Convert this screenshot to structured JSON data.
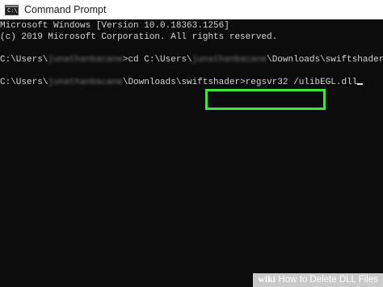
{
  "window": {
    "title": "Command Prompt",
    "icon": "cmd-console-icon",
    "icon_glyph": "C:\\"
  },
  "console": {
    "line1": "Microsoft Windows [Version 10.0.18363.1256]",
    "line2": "(c) 2019 Microsoft Corporation. All rights reserved.",
    "line3_prefix": "C:\\Users\\",
    "line3_user": "junathanbacane",
    "line3_suffix": ">cd C:\\Users\\",
    "line3_user2": "junathanbacane",
    "line3_path_end": "\\Downloads\\swiftshader",
    "line4_prefix": "C:\\Users\\",
    "line4_user": "junathanbacane",
    "line4_path_end": "\\Downloads\\swiftshader",
    "command": ">regsvr32 /ulibEGL.dll"
  },
  "watermark": {
    "brand": "wiki",
    "text": "How to Delete DLL Files"
  },
  "colors": {
    "console_bg": "#0c0c0c",
    "console_text": "#d4d4d4",
    "highlight_border": "#3fe43f"
  }
}
